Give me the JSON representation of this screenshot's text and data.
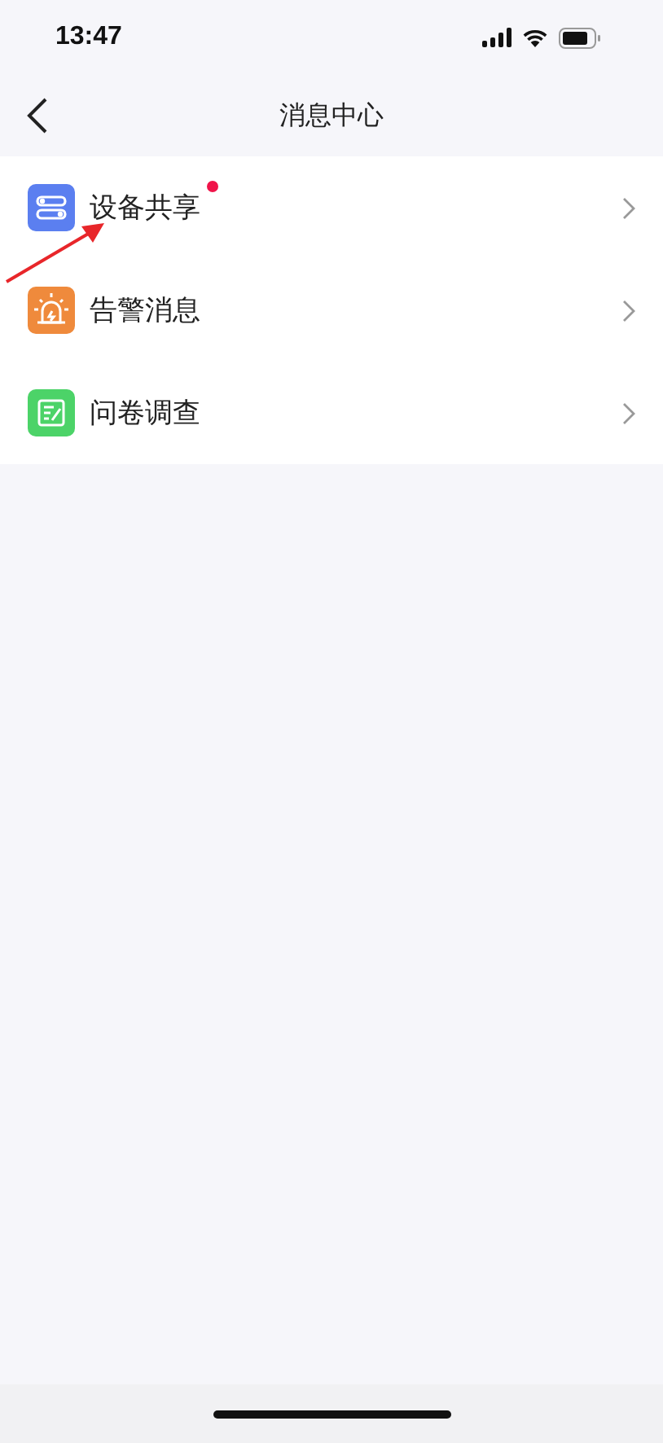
{
  "status_bar": {
    "time": "13:47"
  },
  "nav": {
    "title": "消息中心"
  },
  "items": [
    {
      "kind": "devices",
      "label": "设备共享",
      "color": "#5b7ff0",
      "unread": true
    },
    {
      "kind": "alarm",
      "label": "告警消息",
      "color": "#ef8a3c",
      "unread": false
    },
    {
      "kind": "survey",
      "label": "问卷调查",
      "color": "#4cd368",
      "unread": false
    }
  ],
  "annotation": {
    "kind": "arrow"
  }
}
